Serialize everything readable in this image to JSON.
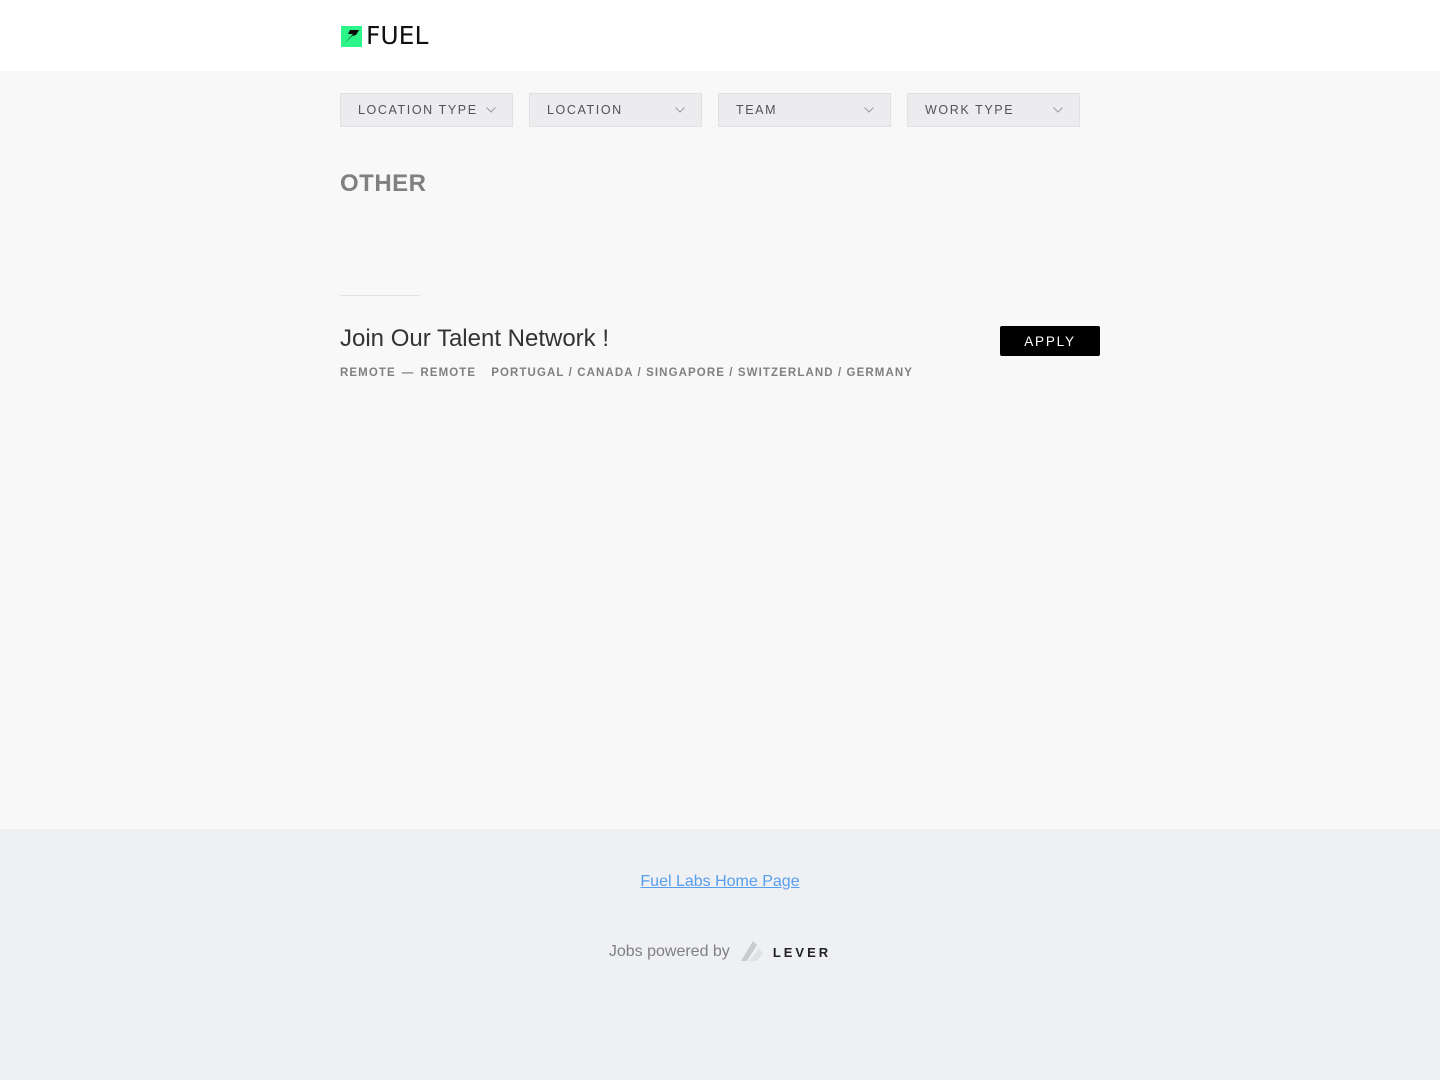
{
  "header": {
    "logo_text": "FUEL",
    "logo_color": "#2cf58a"
  },
  "filters": [
    {
      "label": "LOCATION TYPE"
    },
    {
      "label": "LOCATION"
    },
    {
      "label": "TEAM"
    },
    {
      "label": "WORK TYPE"
    }
  ],
  "section": {
    "title": "OTHER"
  },
  "posting": {
    "title": "Join Our Talent Network !",
    "location_type": "REMOTE",
    "separator": "—",
    "work_type": "REMOTE",
    "locations": "PORTUGAL / CANADA / SINGAPORE / SWITZERLAND / GERMANY",
    "apply_label": "APPLY"
  },
  "footer": {
    "home_link": "Fuel Labs Home Page",
    "powered_by": "Jobs powered by",
    "lever_label": "LEVER",
    "link_color": "#579eee"
  }
}
